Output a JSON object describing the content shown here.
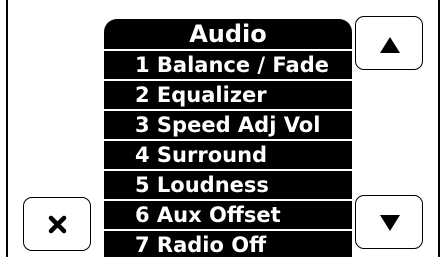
{
  "menu": {
    "title": "Audio",
    "items": [
      {
        "label": "1 Balance / Fade"
      },
      {
        "label": "2 Equalizer"
      },
      {
        "label": "3 Speed Adj Vol"
      },
      {
        "label": "4 Surround"
      },
      {
        "label": "5 Loudness"
      },
      {
        "label": "6 Aux Offset"
      },
      {
        "label": "7 Radio Off"
      }
    ]
  },
  "buttons": {
    "close_icon": "close-icon",
    "scroll_up_icon": "triangle-up-icon",
    "scroll_down_icon": "triangle-down-icon"
  },
  "colors": {
    "background": "#ffffff",
    "menu_background": "#000000",
    "menu_text": "#ffffff",
    "icon": "#000000"
  }
}
